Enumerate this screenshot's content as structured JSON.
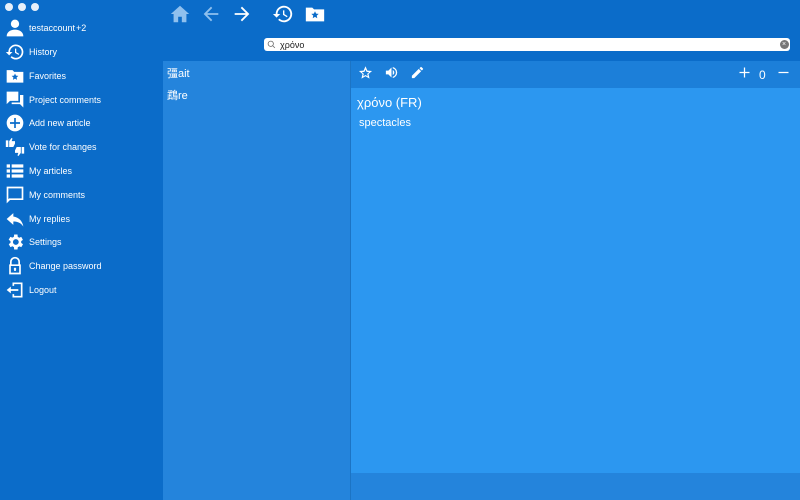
{
  "sidebar": {
    "account": {
      "name": "testaccount",
      "extra": "+2",
      "icon": "person-icon"
    },
    "items": [
      {
        "label": "History",
        "icon": "history-icon"
      },
      {
        "label": "Favorites",
        "icon": "favorites-folder-icon"
      },
      {
        "label": "Project comments",
        "icon": "forum-icon"
      },
      {
        "label": "Add new article",
        "icon": "add-circle-icon"
      },
      {
        "label": "Vote for changes",
        "icon": "thumbs-vote-icon"
      },
      {
        "label": "My articles",
        "icon": "list-icon"
      },
      {
        "label": "My comments",
        "icon": "comment-icon"
      },
      {
        "label": "My replies",
        "icon": "reply-icon"
      },
      {
        "label": "Settings",
        "icon": "gear-icon"
      },
      {
        "label": "Change password",
        "icon": "lock-icon"
      },
      {
        "label": "Logout",
        "icon": "logout-icon"
      }
    ]
  },
  "toolbar": {
    "buttons": [
      "home-icon",
      "back-arrow-icon",
      "forward-arrow-icon",
      "history-icon",
      "favorites-folder-icon"
    ]
  },
  "search": {
    "value": "χρόνο",
    "placeholder": ""
  },
  "results": [
    "彊ait",
    "鵡re"
  ],
  "article": {
    "title": "χρόνο (FR)",
    "body": "spectacles",
    "vote_count": "0",
    "actions": [
      "star-icon",
      "speaker-icon",
      "pencil-icon",
      "plus-icon",
      "minus-icon"
    ]
  },
  "colors": {
    "sidebar": "#0b6cc9",
    "results": "#2484dc",
    "article": "#2c97f0"
  }
}
